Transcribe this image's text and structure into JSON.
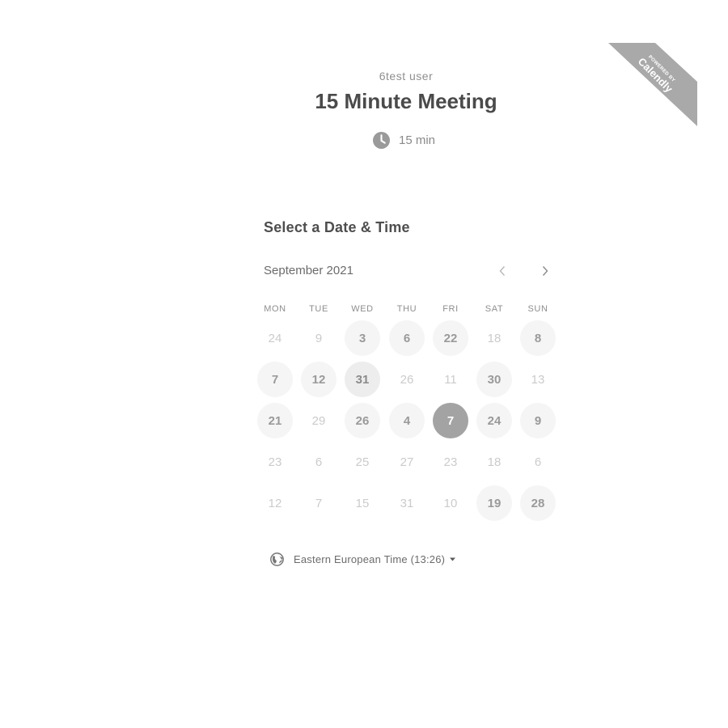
{
  "header": {
    "host_name": "6test user",
    "event_title": "15 Minute Meeting",
    "duration": "15 min",
    "duration_icon": "clock-icon"
  },
  "badge": {
    "line1": "POWERED BY",
    "line2": "Calendly",
    "color": "#a9a9a9"
  },
  "calendar": {
    "section_title": "Select a Date & Time",
    "month_label": "September 2021",
    "prev_icon": "chevron-left-icon",
    "next_icon": "chevron-right-icon",
    "weekdays": [
      "MON",
      "TUE",
      "WED",
      "THU",
      "FRI",
      "SAT",
      "SUN"
    ],
    "weeks": [
      [
        "24",
        "9",
        "3",
        "6",
        "22",
        "18",
        "8"
      ],
      [
        "7",
        "12",
        "31",
        "26",
        "11",
        "30",
        "13"
      ],
      [
        "21",
        "29",
        "26",
        "4",
        "7",
        "24",
        "9"
      ],
      [
        "23",
        "6",
        "25",
        "27",
        "23",
        "18",
        "6"
      ],
      [
        "12",
        "7",
        "15",
        "31",
        "10",
        "19",
        "28"
      ]
    ],
    "states": [
      [
        "disabled",
        "disabled",
        "available",
        "available",
        "available",
        "disabled",
        "available"
      ],
      [
        "available",
        "available",
        "available-strong",
        "disabled",
        "disabled",
        "available",
        "disabled"
      ],
      [
        "available",
        "disabled",
        "available",
        "available",
        "selected",
        "available",
        "available"
      ],
      [
        "disabled",
        "disabled",
        "disabled",
        "disabled",
        "disabled",
        "disabled",
        "disabled"
      ],
      [
        "disabled",
        "disabled",
        "disabled",
        "disabled",
        "disabled",
        "available",
        "available"
      ]
    ],
    "selected_color": "#a3a3a3"
  },
  "timezone": {
    "icon": "globe-icon",
    "label": "Eastern European Time (13:26)",
    "caret_icon": "caret-down-icon"
  }
}
